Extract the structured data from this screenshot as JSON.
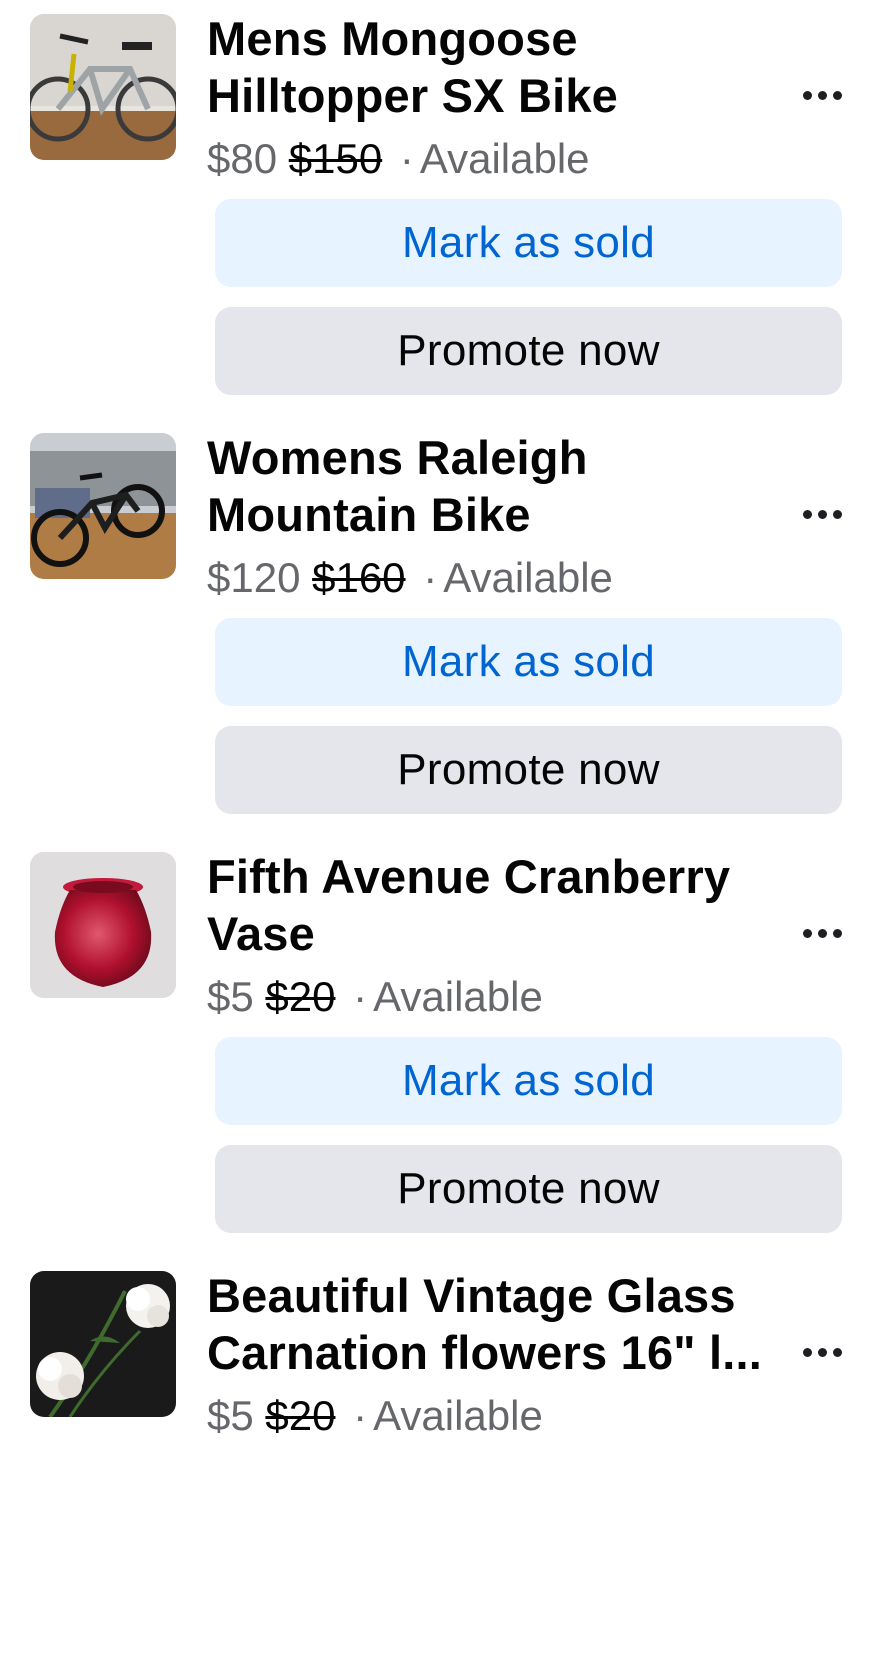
{
  "listings": [
    {
      "title": "Mens Mongoose Hilltopper SX Bike",
      "price": "$80",
      "original_price": "$150",
      "separator": "·",
      "status": "Available",
      "mark_sold_label": "Mark as sold",
      "promote_label": "Promote now",
      "thumbnail": "bike-photo"
    },
    {
      "title": "Womens Raleigh Mountain Bike",
      "price": "$120",
      "original_price": "$160",
      "separator": "·",
      "status": "Available",
      "mark_sold_label": "Mark as sold",
      "promote_label": "Promote now",
      "thumbnail": "bike-photo"
    },
    {
      "title": "Fifth Avenue Cranberry Vase",
      "price": "$5",
      "original_price": "$20",
      "separator": "·",
      "status": "Available",
      "mark_sold_label": "Mark as sold",
      "promote_label": "Promote now",
      "thumbnail": "vase-photo"
    },
    {
      "title": "Beautiful Vintage Glass Carnation flowers 16\" l...",
      "price": "$5",
      "original_price": "$20",
      "separator": "·",
      "status": "Available",
      "thumbnail": "flowers-photo"
    }
  ],
  "icons": {
    "more": "more-options-icon"
  },
  "colors": {
    "accent": "#0064d1",
    "mark_sold_bg": "#e7f3ff",
    "promote_bg": "#e4e6eb",
    "secondary_text": "#65676b"
  }
}
